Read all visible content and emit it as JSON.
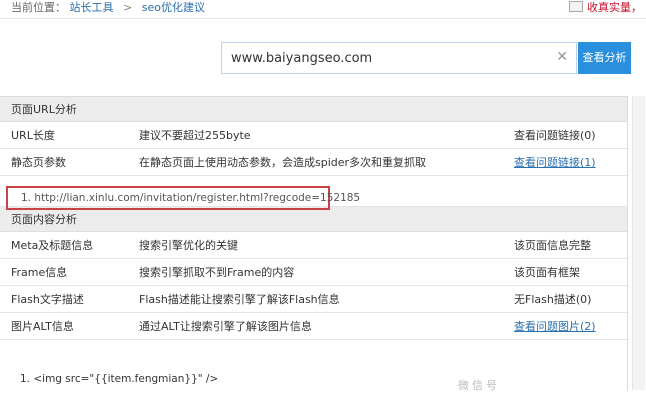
{
  "breadcrumb": {
    "label": "当前位置：",
    "items": [
      "站长工具",
      "seo优化建议"
    ],
    "separator": ">"
  },
  "favorite": {
    "label": "收真实量，"
  },
  "search": {
    "value": "www.baiyangseo.com",
    "clear": "✕",
    "button": "查看分析"
  },
  "sections": [
    {
      "title": "页面URL分析",
      "rows": [
        {
          "name": "URL长度",
          "desc": "建议不要超过255byte",
          "action": "查看问题链接(0)"
        },
        {
          "name": "静态页参数",
          "desc": "在静态页面上使用动态参数，会造成spider多次和重复抓取",
          "action": "查看问题链接(1)"
        }
      ],
      "url_item": "1.   http://lian.xinlu.com/invitation/register.html?regcode=152185"
    },
    {
      "title": "页面内容分析",
      "rows": [
        {
          "name": "Meta及标题信息",
          "desc": "搜索引擎优化的关键",
          "action": "该页面信息完整"
        },
        {
          "name": "Frame信息",
          "desc": "搜索引擎抓取不到Frame的内容",
          "action": "该页面有框架"
        },
        {
          "name": "Flash文字描述",
          "desc": "Flash描述能让搜索引擎了解该Flash信息",
          "action": "无Flash描述(0)"
        },
        {
          "name": "图片ALT信息",
          "desc": "通过ALT让搜索引擎了解该图片信息",
          "action": "查看问题图片(2)"
        }
      ],
      "code_item": "1.  <img src=\"{{item.fengmian}}\" />"
    }
  ],
  "watermark": "微信号"
}
